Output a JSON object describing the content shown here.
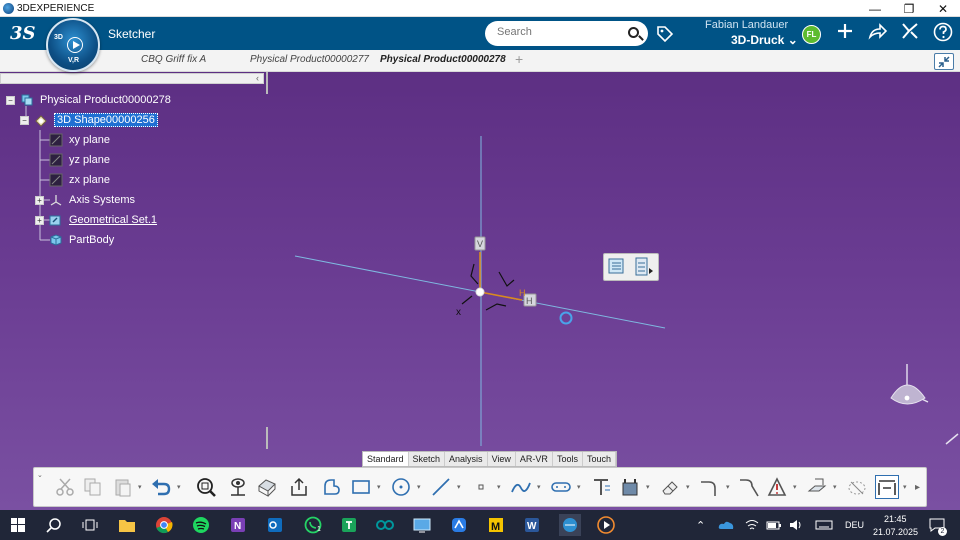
{
  "window": {
    "title": "3DEXPERIENCE",
    "min_label": "—",
    "restore_label": "❐",
    "close_label": "✕"
  },
  "header": {
    "compass_top": "3D",
    "compass_bottom": "V,R",
    "app_name": "Sketcher",
    "search_placeholder": "Search",
    "user_name": "Fabian Landauer",
    "tenant": "3D-Druck",
    "user_initials": "FL"
  },
  "tabs": [
    {
      "label": "CBQ Griff fix A",
      "active": false
    },
    {
      "label": "Physical Product00000277",
      "active": false
    },
    {
      "label": "Physical Product00000278",
      "active": true
    }
  ],
  "tab_add": "+",
  "tree_collapse_label": "‹",
  "tree": {
    "root": "Physical Product00000278",
    "shape": "3D Shape00000256",
    "items": [
      "xy plane",
      "yz plane",
      "zx plane",
      "Axis Systems",
      "Geometrical Set.1",
      "PartBody"
    ]
  },
  "sketch_labels": {
    "v": "V",
    "h": "H",
    "x": "x"
  },
  "toolbar_tabs": [
    "Standard",
    "Sketch",
    "Analysis",
    "View",
    "AR-VR",
    "Tools",
    "Touch"
  ],
  "toolbar_active_tab": "Sketch",
  "toolbar_more": "▸",
  "taskbar": {
    "language": "DEU",
    "time": "21:45",
    "date": "21.07.2025",
    "notification_count": "2",
    "outlook_badge": "1"
  },
  "colors": {
    "header": "#005386",
    "viewport_top": "#5d2f83",
    "viewport_bottom": "#7a50a2",
    "selection": "#1f6fd2",
    "axis": "#7fb8e0",
    "sketch": "#d98a1f",
    "avatar": "#5dbb2f"
  },
  "icons": {
    "tag": "tag-icon",
    "add": "plus-icon",
    "share": "share-icon",
    "tools": "tools-icon",
    "help": "help-icon"
  }
}
